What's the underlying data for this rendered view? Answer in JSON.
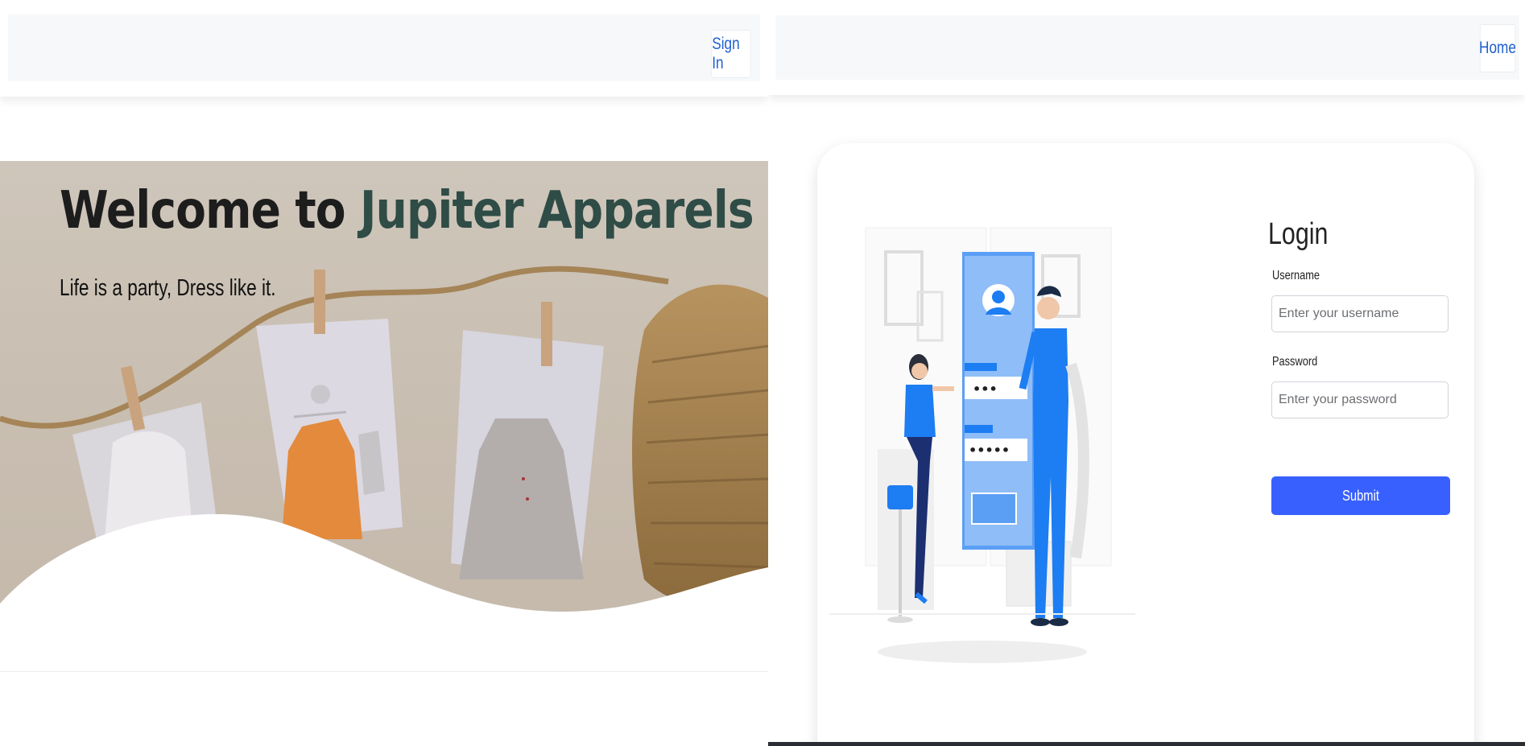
{
  "left_page": {
    "navbar": {
      "signin_label": "Sign In"
    },
    "hero": {
      "title_prefix": "Welcome to ",
      "title_brand": "Jupiter Apparels",
      "tagline": "Life is a party, Dress like it."
    }
  },
  "right_page": {
    "navbar": {
      "home_label": "Home"
    },
    "login": {
      "title": "Login",
      "username_label": "Username",
      "username_placeholder": "Enter your username",
      "password_label": "Password",
      "password_placeholder": "Enter your password",
      "submit_label": "Submit",
      "illustration": {
        "password_mask_1": "•••",
        "password_mask_2": "•••••"
      }
    }
  },
  "colors": {
    "accent": "#3860ff",
    "link": "#1f5fd0",
    "brand_text": "#2f4c46",
    "illustration_blue": "#1d7df2"
  }
}
